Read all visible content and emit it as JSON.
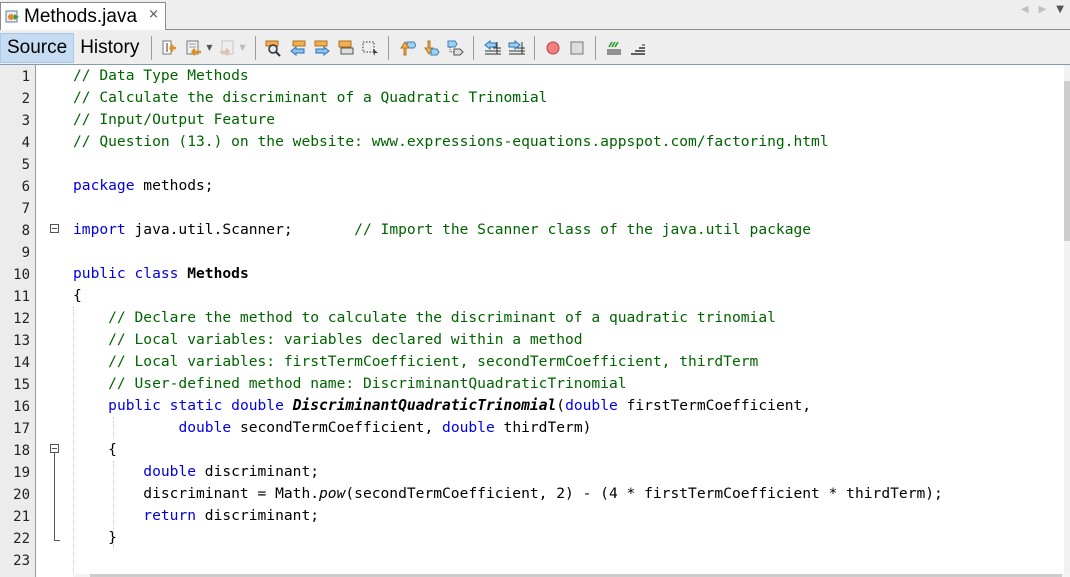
{
  "tab": {
    "title": "Methods.java",
    "close_icon": "×",
    "icon": "java-file-icon"
  },
  "nav": {
    "prev": "◀",
    "next": "▶",
    "menu": "▼"
  },
  "toolbar": {
    "source_label": "Source",
    "history_label": "History",
    "buttons": [
      "last-edit-icon",
      "back-icon",
      "forward-icon",
      "find-selection-icon",
      "find-previous-icon",
      "find-next-icon",
      "toggle-highlight-icon",
      "toggle-rect-select-icon",
      "previous-bookmark-icon",
      "next-bookmark-icon",
      "toggle-bookmark-icon",
      "shift-left-icon",
      "shift-right-icon",
      "start-macro-icon",
      "stop-macro-icon",
      "comment-icon",
      "uncomment-icon"
    ]
  },
  "editor": {
    "line_numbers": [
      "1",
      "2",
      "3",
      "4",
      "5",
      "6",
      "7",
      "8",
      "9",
      "10",
      "11",
      "12",
      "13",
      "14",
      "15",
      "16",
      "17",
      "18",
      "19",
      "20",
      "21",
      "22",
      "23"
    ],
    "lines": [
      [
        {
          "t": "// Data Type Methods",
          "c": "cm"
        }
      ],
      [
        {
          "t": "// Calculate the discriminant of a Quadratic Trinomial",
          "c": "cm"
        }
      ],
      [
        {
          "t": "// Input/Output Feature",
          "c": "cm"
        }
      ],
      [
        {
          "t": "// Question (13.) on the website: www.expressions-equations.appspot.com/factoring.html",
          "c": "cm"
        }
      ],
      [],
      [
        {
          "t": "package",
          "c": "kw"
        },
        {
          "t": " methods;",
          "c": ""
        }
      ],
      [],
      [
        {
          "t": "import",
          "c": "kw"
        },
        {
          "t": " java.util.Scanner;       ",
          "c": ""
        },
        {
          "t": "// Import the Scanner class of the java.util package",
          "c": "cm"
        }
      ],
      [],
      [
        {
          "t": "public class",
          "c": "kw"
        },
        {
          "t": " ",
          "c": ""
        },
        {
          "t": "Methods",
          "c": "bold"
        }
      ],
      [
        {
          "t": "{",
          "c": ""
        }
      ],
      [
        {
          "t": "    // Declare the method to calculate the discriminant of a quadratic trinomial",
          "c": "cm"
        }
      ],
      [
        {
          "t": "    // Local variables: variables declared within a method",
          "c": "cm"
        }
      ],
      [
        {
          "t": "    // Local variables: firstTermCoefficient, secondTermCoefficient, thirdTerm",
          "c": "cm"
        }
      ],
      [
        {
          "t": "    // User-defined method name: DiscriminantQuadraticTrinomial",
          "c": "cm"
        }
      ],
      [
        {
          "t": "    ",
          "c": ""
        },
        {
          "t": "public static double",
          "c": "kw"
        },
        {
          "t": " ",
          "c": ""
        },
        {
          "t": "DiscriminantQuadraticTrinomial",
          "c": "mth"
        },
        {
          "t": "(",
          "c": ""
        },
        {
          "t": "double",
          "c": "kw"
        },
        {
          "t": " firstTermCoefficient,",
          "c": ""
        }
      ],
      [
        {
          "t": "            ",
          "c": ""
        },
        {
          "t": "double",
          "c": "kw"
        },
        {
          "t": " secondTermCoefficient, ",
          "c": ""
        },
        {
          "t": "double",
          "c": "kw"
        },
        {
          "t": " thirdTerm)",
          "c": ""
        }
      ],
      [
        {
          "t": "    {",
          "c": ""
        }
      ],
      [
        {
          "t": "        ",
          "c": ""
        },
        {
          "t": "double",
          "c": "kw"
        },
        {
          "t": " discriminant;",
          "c": ""
        }
      ],
      [
        {
          "t": "        discriminant = Math.",
          "c": ""
        },
        {
          "t": "pow",
          "c": "it"
        },
        {
          "t": "(secondTermCoefficient, 2) - (4 * firstTermCoefficient * thirdTerm);",
          "c": ""
        }
      ],
      [
        {
          "t": "        ",
          "c": ""
        },
        {
          "t": "return",
          "c": "kw"
        },
        {
          "t": " discriminant;",
          "c": ""
        }
      ],
      [
        {
          "t": "    }",
          "c": ""
        }
      ],
      []
    ]
  }
}
